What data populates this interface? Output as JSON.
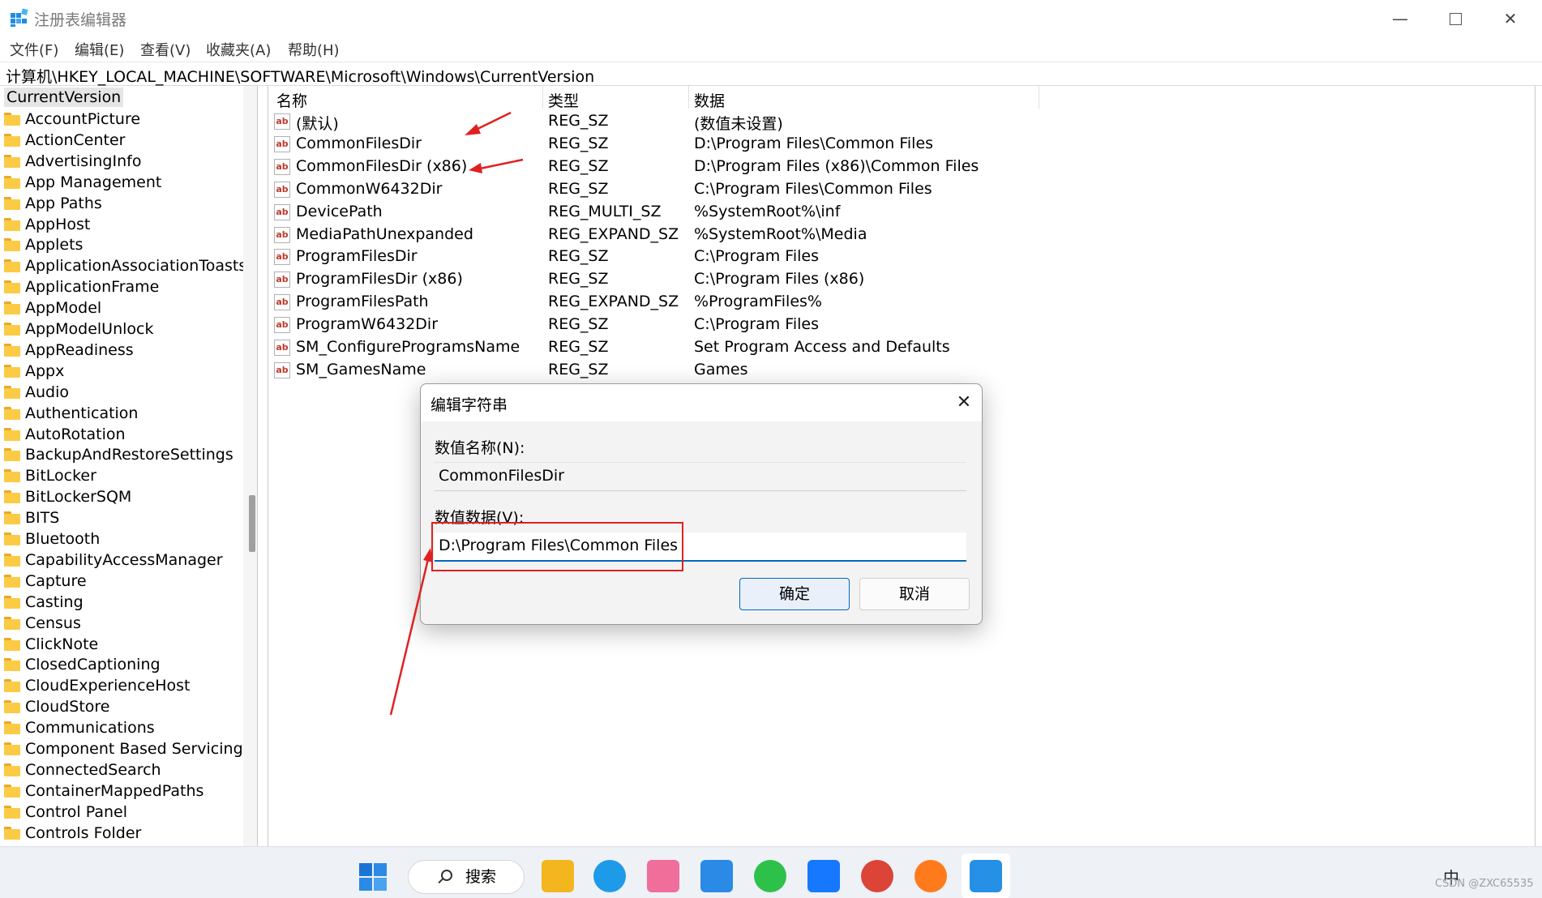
{
  "window": {
    "title": "注册表编辑器",
    "controls": {
      "minimize": "—",
      "close": "✕"
    }
  },
  "menu": [
    "文件(F)",
    "编辑(E)",
    "查看(V)",
    "收藏夹(A)",
    "帮助(H)"
  ],
  "address": "计算机\\HKEY_LOCAL_MACHINE\\SOFTWARE\\Microsoft\\Windows\\CurrentVersion",
  "tree": {
    "root": "CurrentVersion",
    "items": [
      "AccountPicture",
      "ActionCenter",
      "AdvertisingInfo",
      "App Management",
      "App Paths",
      "AppHost",
      "Applets",
      "ApplicationAssociationToasts",
      "ApplicationFrame",
      "AppModel",
      "AppModelUnlock",
      "AppReadiness",
      "Appx",
      "Audio",
      "Authentication",
      "AutoRotation",
      "BackupAndRestoreSettings",
      "BitLocker",
      "BitLockerSQM",
      "BITS",
      "Bluetooth",
      "CapabilityAccessManager",
      "Capture",
      "Casting",
      "Census",
      "ClickNote",
      "ClosedCaptioning",
      "CloudExperienceHost",
      "CloudStore",
      "Communications",
      "Component Based Servicing",
      "ConnectedSearch",
      "ContainerMappedPaths",
      "Control Panel",
      "Controls Folder"
    ]
  },
  "list": {
    "columns": {
      "name": "名称",
      "type": "类型",
      "data": "数据"
    },
    "icon_text": "ab",
    "rows": [
      {
        "name": "(默认)",
        "type": "REG_SZ",
        "data": "(数值未设置)"
      },
      {
        "name": "CommonFilesDir",
        "type": "REG_SZ",
        "data": "D:\\Program Files\\Common Files"
      },
      {
        "name": "CommonFilesDir (x86)",
        "type": "REG_SZ",
        "data": "D:\\Program Files (x86)\\Common Files"
      },
      {
        "name": "CommonW6432Dir",
        "type": "REG_SZ",
        "data": "C:\\Program Files\\Common Files"
      },
      {
        "name": "DevicePath",
        "type": "REG_MULTI_SZ",
        "data": "%SystemRoot%\\inf"
      },
      {
        "name": "MediaPathUnexpanded",
        "type": "REG_EXPAND_SZ",
        "data": "%SystemRoot%\\Media"
      },
      {
        "name": "ProgramFilesDir",
        "type": "REG_SZ",
        "data": "C:\\Program Files"
      },
      {
        "name": "ProgramFilesDir (x86)",
        "type": "REG_SZ",
        "data": "C:\\Program Files (x86)"
      },
      {
        "name": "ProgramFilesPath",
        "type": "REG_EXPAND_SZ",
        "data": "%ProgramFiles%"
      },
      {
        "name": "ProgramW6432Dir",
        "type": "REG_SZ",
        "data": "C:\\Program Files"
      },
      {
        "name": "SM_ConfigureProgramsName",
        "type": "REG_SZ",
        "data": "Set Program Access and Defaults"
      },
      {
        "name": "SM_GamesName",
        "type": "REG_SZ",
        "data": "Games"
      }
    ]
  },
  "dialog": {
    "title": "编辑字符串",
    "close": "✕",
    "name_label": "数值名称(N):",
    "name_value": "CommonFilesDir",
    "data_label": "数值数据(V):",
    "data_value": "D:\\Program Files\\Common Files",
    "ok": "确定",
    "cancel": "取消"
  },
  "taskbar": {
    "search": "搜索",
    "tray_ime": "中",
    "watermark": "CSDN @ZXC65535"
  },
  "colors": {
    "annotation": "#e02020",
    "accent": "#0067c0",
    "folder": "#fbcb46"
  }
}
